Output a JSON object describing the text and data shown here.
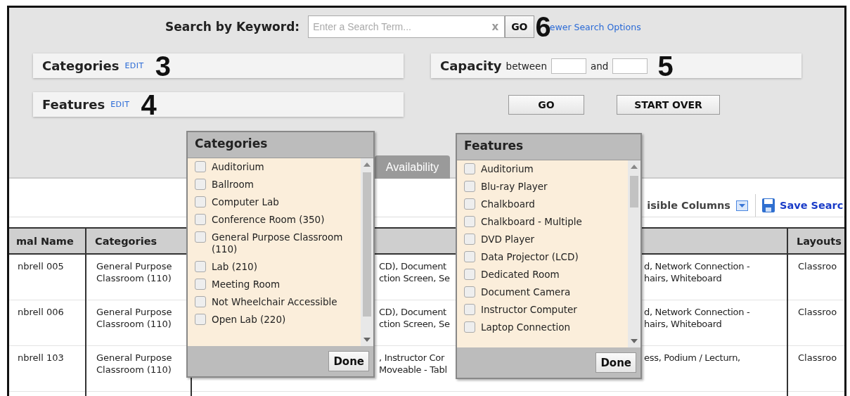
{
  "search": {
    "label": "Search by Keyword:",
    "placeholder": "Enter a Search Term...",
    "clear": "x",
    "go": "GO",
    "link": "ewer Search Options"
  },
  "filters": {
    "categories": {
      "label": "Categories",
      "edit": "EDIT"
    },
    "features": {
      "label": "Features",
      "edit": "EDIT"
    },
    "capacity": {
      "label": "Capacity",
      "between": "between",
      "and": "and"
    },
    "go": "GO",
    "start_over": "START OVER"
  },
  "annotations": [
    {
      "kind": "search",
      "text": "6"
    },
    {
      "kind": "categories",
      "text": "3"
    },
    {
      "kind": "features",
      "text": "4"
    },
    {
      "kind": "capacity",
      "text": "5"
    }
  ],
  "tab": {
    "label": "Availability",
    "selected": false
  },
  "toolbar": {
    "columns": "isible Columns",
    "save": "Save Searc"
  },
  "table": {
    "columns": [
      "mal Name",
      "Categories",
      "",
      "Layouts"
    ],
    "rows": [
      {
        "name": "nbrell 005",
        "categories": "General Purpose Classroom (110)",
        "left": [
          "CD), Document",
          "ction Screen, Se"
        ],
        "right": [
          "d, Network Connection -",
          "hairs, Whiteboard"
        ],
        "layouts": "Classroo"
      },
      {
        "name": "nbrell 006",
        "categories": "General Purpose Classroom (110)",
        "left": [
          "CD), Document",
          "ction Screen, Se"
        ],
        "right": [
          "d, Network Connection -",
          "hairs, Whiteboard"
        ],
        "layouts": "Classroo"
      },
      {
        "name": "nbrell 103",
        "categories": "General Purpose Classroom (110)",
        "left": [
          ", Instructor Cor",
          "Moveable - Tabl"
        ],
        "right": [
          "ess, Podium / Lecturn,"
        ],
        "layouts": "Classroo"
      }
    ]
  },
  "popups": [
    {
      "kind": "categories",
      "title": "Categories",
      "done": "Done",
      "items": [
        {
          "label": "Auditorium",
          "checked": false
        },
        {
          "label": "Ballroom",
          "checked": false
        },
        {
          "label": "Computer Lab",
          "checked": false
        },
        {
          "label": "Conference Room (350)",
          "checked": false
        },
        {
          "label": "General Purpose Classroom (110)",
          "checked": false
        },
        {
          "label": "Lab (210)",
          "checked": false
        },
        {
          "label": "Meeting Room",
          "checked": false
        },
        {
          "label": "Not Wheelchair Accessible",
          "checked": false
        },
        {
          "label": "Open Lab (220)",
          "checked": false
        }
      ]
    },
    {
      "kind": "features",
      "title": "Features",
      "done": "Done",
      "items": [
        {
          "label": "Auditorium",
          "checked": false
        },
        {
          "label": "Blu-ray Player",
          "checked": false
        },
        {
          "label": "Chalkboard",
          "checked": false
        },
        {
          "label": "Chalkboard - Multiple",
          "checked": false
        },
        {
          "label": "DVD Player",
          "checked": false
        },
        {
          "label": "Data Projector (LCD)",
          "checked": false
        },
        {
          "label": "Dedicated Room",
          "checked": false
        },
        {
          "label": "Document Camera",
          "checked": false
        },
        {
          "label": "Instructor Computer",
          "checked": false
        },
        {
          "label": "Laptop Connection",
          "checked": false
        }
      ]
    }
  ]
}
